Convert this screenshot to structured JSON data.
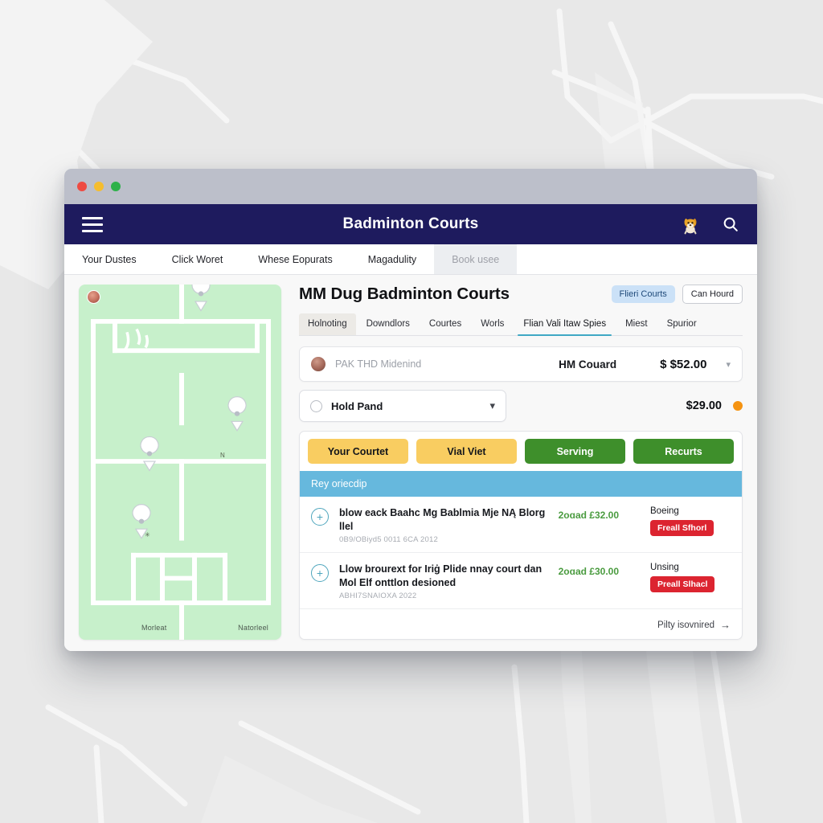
{
  "window": {
    "traffic_lights": [
      "close",
      "minimize",
      "zoom"
    ]
  },
  "header": {
    "menu_icon": "hamburger-icon",
    "title": "Badminton Courts",
    "mascot_icon": "mascot-avatar-icon",
    "search_icon": "search-icon"
  },
  "tabs": [
    {
      "label": "Your Dustes",
      "active": true
    },
    {
      "label": "Click Woret",
      "active": false
    },
    {
      "label": "Whese Eopurats",
      "active": false
    },
    {
      "label": "Magadulity",
      "active": false
    },
    {
      "label": "Book usee",
      "active": false,
      "muted": true
    }
  ],
  "map": {
    "avatar_icon": "map-user-avatar",
    "pins": [
      "pin-top-right",
      "pin-mid-right",
      "pin-center",
      "pin-lower-left"
    ],
    "labels": {
      "bottom_left": "Morleat",
      "bottom_right": "Natorleel",
      "marker_n": "N",
      "marker_x": "✳"
    }
  },
  "main": {
    "page_title": "MM Dug Badminton Courts",
    "actions": [
      {
        "label": "Flieri Courts",
        "style": "blue"
      },
      {
        "label": "Can Hourd",
        "style": "ghost"
      }
    ],
    "subtabs": [
      {
        "label": "Holnoting",
        "state": "first"
      },
      {
        "label": "Downdlors",
        "state": "normal"
      },
      {
        "label": "Courtes",
        "state": "normal"
      },
      {
        "label": "Worls",
        "state": "normal"
      },
      {
        "label": "Flian Vali Itaw Spies",
        "state": "active"
      },
      {
        "label": "Miest",
        "state": "normal"
      },
      {
        "label": "Spurior",
        "state": "normal"
      }
    ],
    "account_row": {
      "avatar_icon": "user-avatar",
      "name": "PAK THD Midenind",
      "middle": "HM Couard",
      "price": "$ $52.00",
      "caret_icon": "chevron-down-icon"
    },
    "select_row": {
      "radio_icon": "radio-unselected-icon",
      "label": "Hold Pand",
      "chevron_icon": "chevron-down-icon",
      "price": "$29.00",
      "status_dot_color": "#f59311"
    },
    "buttons": [
      {
        "label": "Your Courtet",
        "style": "yellow"
      },
      {
        "label": "Vial Viet",
        "style": "yellow"
      },
      {
        "label": "Serving",
        "style": "green"
      },
      {
        "label": "Recurts",
        "style": "green"
      }
    ],
    "section_bar": "Rey oriecdip",
    "list": [
      {
        "add_icon": "plus-circle-icon",
        "title": "blow eack Baahc Mg Bablmia Mje NĄ Blorg llel",
        "subtitle": "0B9/OBiyd5 0011 6CA 2012",
        "price": "2oɑad £32.00",
        "status": "Boeing",
        "action_label": "Freall Sfhorl"
      },
      {
        "add_icon": "plus-circle-icon",
        "title": "Llow brourext for Iriġ Plide nnay court dan Mol Elf onttlon desioned",
        "subtitle": "ABHI7SNAIOXA 2022",
        "price": "2oɑad £30.00",
        "status": "Unsing",
        "action_label": "Preall Slhacl"
      }
    ],
    "footer": {
      "link": "Pilty isovnired",
      "arrow_icon": "arrow-right-icon"
    }
  },
  "colors": {
    "navy": "#1e1b5e",
    "titlebar": "#bcbfca",
    "map_green": "#c7f0cb",
    "accent_blue": "#66b8dd",
    "green_button": "#3e8f2b",
    "yellow_button": "#f9cd61",
    "red_badge": "#dc2430",
    "orange_dot": "#f59311",
    "price_green": "#4a9b3f"
  }
}
